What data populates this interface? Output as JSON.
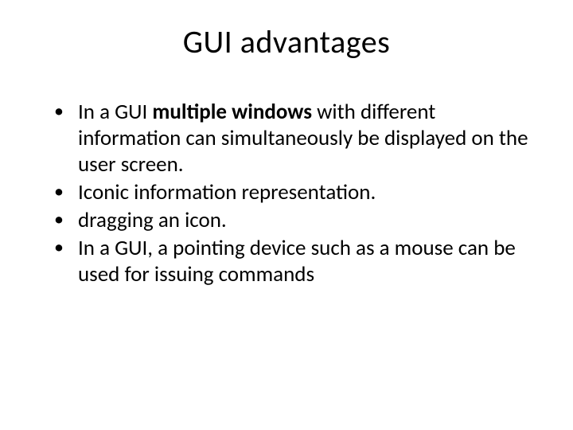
{
  "title": "GUI advantages",
  "bullets": {
    "b0_pre": "In a GUI ",
    "b0_bold": "multiple windows ",
    "b0_post": "with different information can simultaneously be displayed on the user screen.",
    "b1": "Iconic information representation.",
    "b2": "dragging an icon.",
    "b3": "In a GUI, a pointing device such as a mouse can be used for issuing commands"
  }
}
